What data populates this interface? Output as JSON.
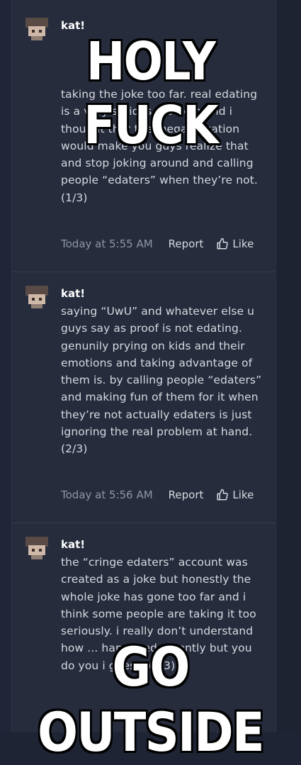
{
  "posts": [
    {
      "user": "kat!",
      "message": "taking the joke too far. real edating is a very serious problem and i thought that the mega situation would make you guys realize that and stop joking around and calling people “edaters” when they’re not. (1/3)",
      "time": "Today at 5:55 AM",
      "report_label": "Report",
      "like_label": "Like"
    },
    {
      "user": "kat!",
      "message": "saying “UwU” and whatever else u guys say as proof is not edating. genunily prying on kids and their emotions and taking advantage of them is. by calling people “edaters” and making fun of them for it when they’re not actually edaters is just ignoring the real problem at hand. (2/3)",
      "time": "Today at 5:56 AM",
      "report_label": "Report",
      "like_label": "Like"
    },
    {
      "user": "kat!",
      "message": "the “cringe edaters” account was created as a joke but honestly the whole joke has gone too far and i think some people are taking it too seriously. i really don’t understand how ... happened recently but you do you i guess. (3/3)",
      "time": "",
      "report_label": "",
      "like_label": ""
    }
  ],
  "captions": {
    "top": "HOLY FUCK",
    "bottom": "GO OUTSIDE"
  },
  "icons": {
    "like": "thumbs-up-icon",
    "avatar": "pixel-avatar"
  },
  "colors": {
    "background": "#1e2433",
    "panel": "#262c3c",
    "text": "#d6d9e0",
    "muted": "#8e95a3"
  }
}
